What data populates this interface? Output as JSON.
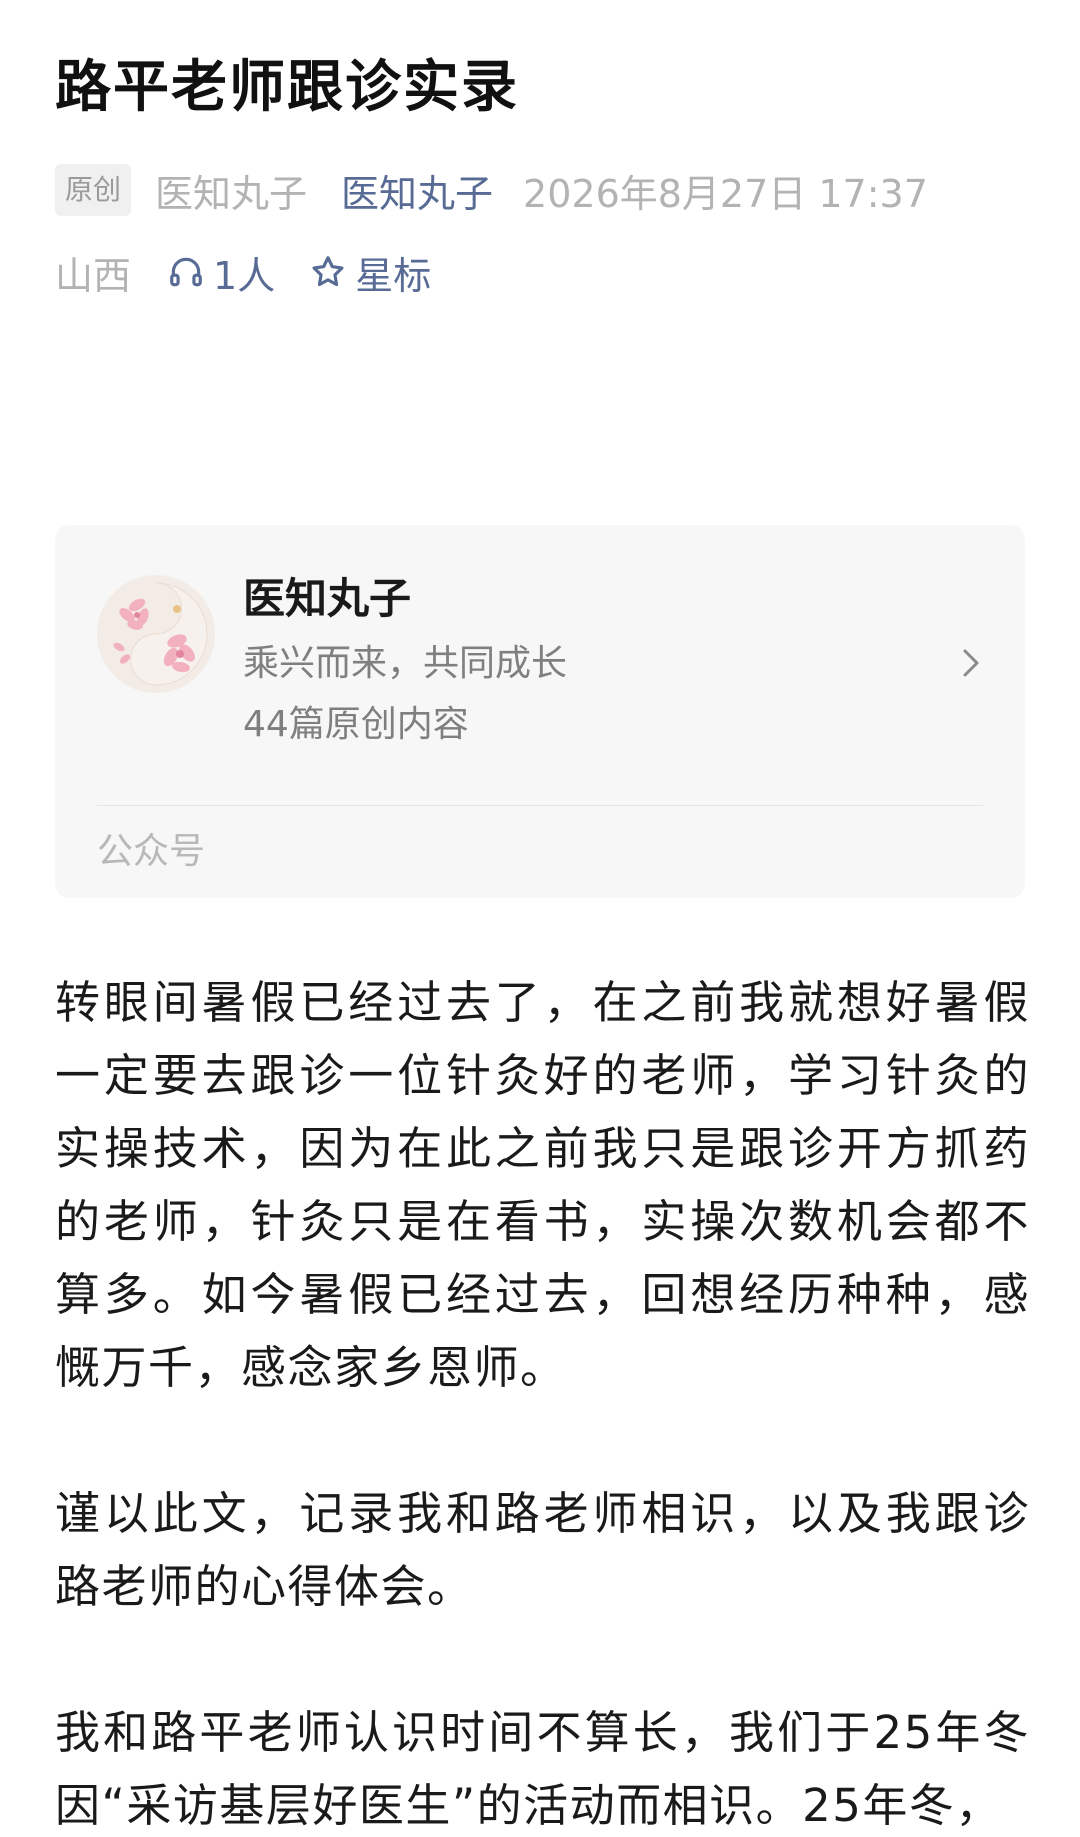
{
  "article": {
    "title": "路平老师跟诊实录",
    "meta": {
      "original_tag": "原创",
      "author": "医知丸子",
      "account_name": "医知丸子",
      "date": "2026年8月27日 17:37",
      "region": "山西",
      "listen_count": "1人",
      "star_label": "星标"
    },
    "paragraphs": [
      "转眼间暑假已经过去了，在之前我就想好暑假一定要去跟诊一位针灸好的老师，学习针灸的实操技术，因为在此之前我只是跟诊开方抓药的老师，针灸只是在看书，实操次数机会都不算多。如今暑假已经过去，回想经历种种，感慨万千，感念家乡恩师。",
      "谨以此文，记录我和路老师相识，以及我跟诊路老师的心得体会。",
      "我和路平老师认识时间不算长，我们于25年冬因“采访基层好医生”的活动而相识。25年冬，"
    ]
  },
  "account_card": {
    "name": "医知丸子",
    "description": "乘兴而来，共同成长",
    "original_count": "44篇原创内容",
    "footer_label": "公众号",
    "avatar_icon": "lotus-yinyang-avatar"
  },
  "colors": {
    "link": "#576b95",
    "muted": "#b3b3b3",
    "card_bg": "#f7f7f7",
    "text": "#1a1a1a"
  },
  "icons": {
    "listen": "headphones-icon",
    "star": "star-outline-icon",
    "arrow": "chevron-right-icon"
  }
}
